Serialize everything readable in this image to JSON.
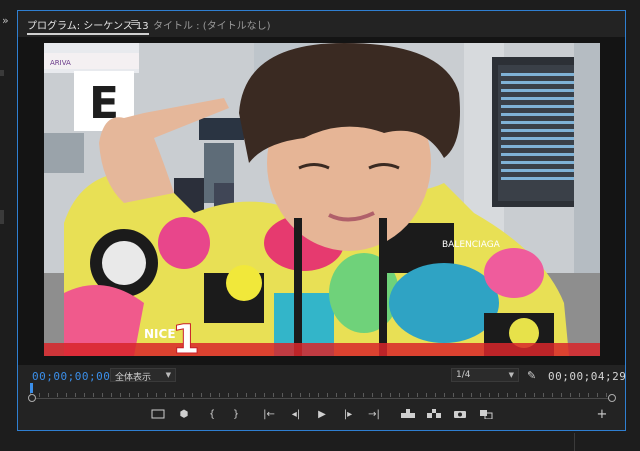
{
  "tabs": {
    "program_label": "プログラム: シーケンス 13",
    "menu_icon": "≡",
    "title_label": "タイトル : (タイトルなし)"
  },
  "gutter": {
    "expand": "»"
  },
  "monitor": {
    "board_logo": "ARIVA",
    "gate_letter": "E",
    "overlay_number": "1",
    "hoodie_text": "BALENCIAGA",
    "sleeve_text": "NICE"
  },
  "transport": {
    "current_time": "00;00;00;00",
    "fit_label": "全体表示",
    "resolution_label": "1/4",
    "duration": "00;00;04;29",
    "playhead_fraction": 0.0
  },
  "controls": {
    "marker": "⬢",
    "in_point": "{",
    "out_point": "}",
    "go_to_in": "|←",
    "step_back": "◂|",
    "play": "▶",
    "step_forward": "|▸",
    "go_to_out": "→|",
    "add": "+"
  },
  "colors": {
    "accent": "#2f7fd1",
    "timecode": "#3b8ee8"
  }
}
